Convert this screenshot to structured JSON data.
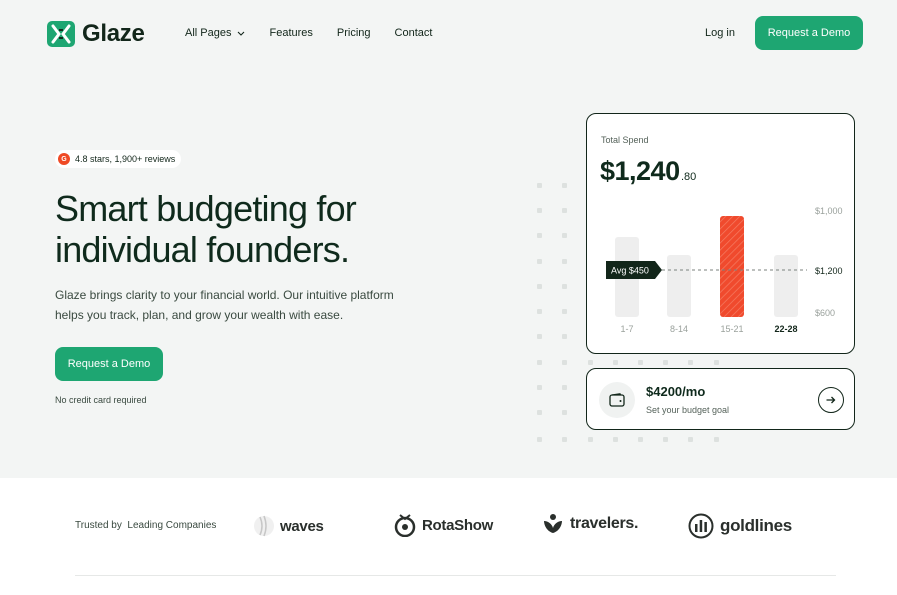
{
  "header": {
    "brand": "Glaze",
    "nav": [
      {
        "label": "All Pages",
        "has_dropdown": true
      },
      {
        "label": "Features"
      },
      {
        "label": "Pricing"
      },
      {
        "label": "Contact"
      }
    ],
    "login_label": "Log in",
    "cta_label": "Request a Demo"
  },
  "hero": {
    "rating": "4.8 stars, 1,900+ reviews",
    "rating_badge": "G",
    "headline_line1": "Smart budgeting for",
    "headline_line2": "individual founders.",
    "subtext": "Glaze brings clarity to your financial world. Our intuitive platform helps you track, plan, and grow your wealth with ease.",
    "cta_label": "Request a Demo",
    "note": "No credit card required"
  },
  "spend_card": {
    "label": "Total Spend",
    "amount": "$1,240",
    "cents": ".80",
    "avg_label": "Avg $450",
    "y_labels": [
      "$1,000",
      "$1,200",
      "$600"
    ],
    "chart_data": {
      "type": "bar",
      "categories": [
        "1-7",
        "8-14",
        "15-21",
        "22-28"
      ],
      "highlighted_category": "15-21",
      "bold_category": "22-28"
    }
  },
  "goal_card": {
    "amount": "$4200/mo",
    "subtitle": "Set your budget goal"
  },
  "trusted": {
    "label": "Trusted by  Leading Companies",
    "logos": [
      "waves",
      "RotaShow",
      "travelers.",
      "goldlines"
    ]
  },
  "colors": {
    "accent": "#1ea672",
    "dark": "#0f2a1c",
    "highlight_bar": "#f04a2d",
    "hero_bg": "#f3f5f4"
  }
}
